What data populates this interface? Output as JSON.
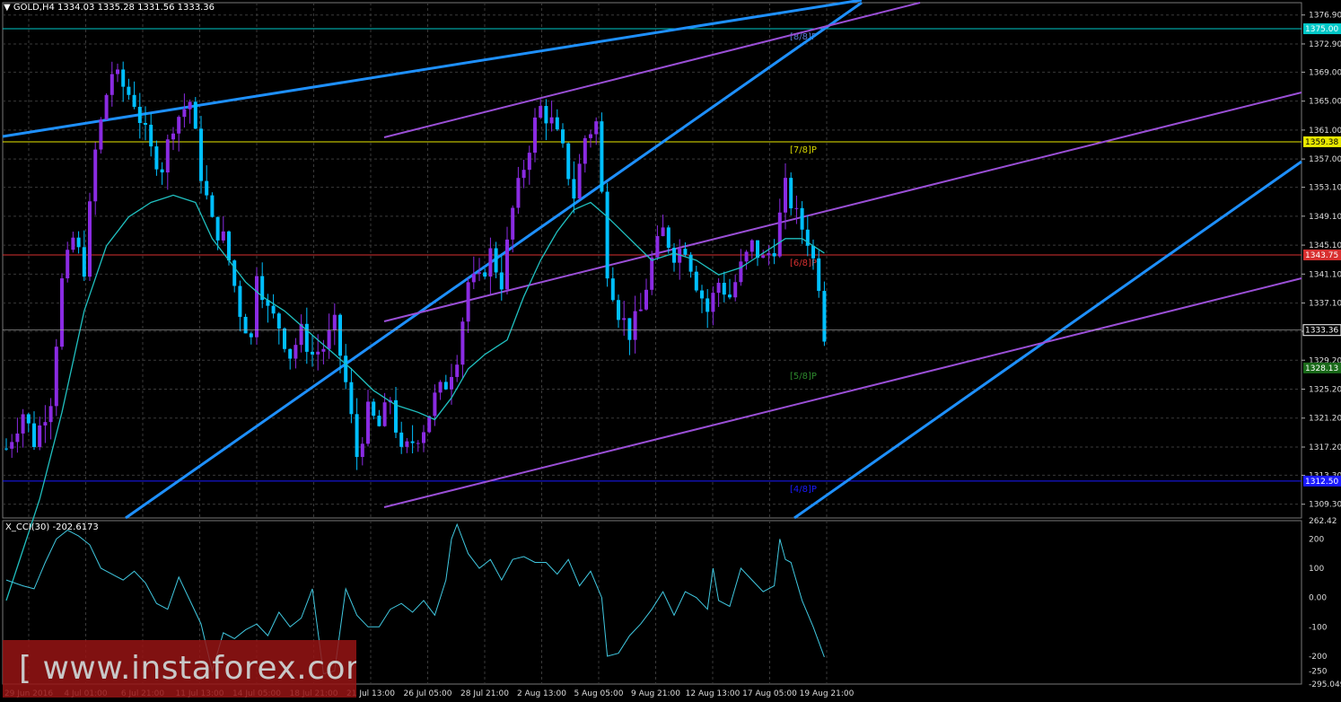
{
  "header": {
    "symbol": "GOLD,H4",
    "ohlc": "1334.03 1335.28 1331.56 1333.36"
  },
  "cci_header": "X_CCI(30) -202.6173",
  "watermark": "[ www.instaforex.com ]",
  "colors": {
    "background": "#000000",
    "grid": "#3a3a3a",
    "bull": "#8a2be2",
    "bear": "#00bfff",
    "bull_body": "#4fd44f",
    "ma": "#20c0c0",
    "channel_blue": "#1e90ff",
    "channel_purple": "#9a4fd6",
    "cci": "#40c8e0"
  },
  "chart_data": [
    {
      "type": "candlestick",
      "symbol": "GOLD",
      "timeframe": "H4",
      "ylim": [
        1307.4,
        1378.6
      ],
      "y_ticks": [
        "1376.90",
        "1372.90",
        "1369.00",
        "1365.00",
        "1361.00",
        "1357.00",
        "1353.10",
        "1349.10",
        "1345.10",
        "1341.10",
        "1337.10",
        "1333.20",
        "1329.20",
        "1325.20",
        "1321.20",
        "1317.20",
        "1313.30",
        "1309.30"
      ],
      "x_ticks": [
        "29 Jun 2016",
        "4 Jul 01:00",
        "6 Jul 21:00",
        "11 Jul 13:00",
        "14 Jul 05:00",
        "18 Jul 21:00",
        "21 Jul 13:00",
        "26 Jul 05:00",
        "28 Jul 21:00",
        "2 Aug 13:00",
        "5 Aug 05:00",
        "9 Aug 21:00",
        "12 Aug 13:00",
        "17 Aug 05:00",
        "19 Aug 21:00"
      ],
      "current_price": "1333.36",
      "close_path": [
        [
          0,
          1317
        ],
        [
          3,
          1322
        ],
        [
          5,
          1318
        ],
        [
          8,
          1324
        ],
        [
          10,
          1340
        ],
        [
          12,
          1346
        ],
        [
          14,
          1342
        ],
        [
          16,
          1358
        ],
        [
          18,
          1366
        ],
        [
          19,
          1369
        ],
        [
          21,
          1367
        ],
        [
          23,
          1365
        ],
        [
          26,
          1358
        ],
        [
          28,
          1356
        ],
        [
          30,
          1362
        ],
        [
          33,
          1365
        ],
        [
          35,
          1355
        ],
        [
          37,
          1348
        ],
        [
          39,
          1346
        ],
        [
          40,
          1343
        ],
        [
          42,
          1336
        ],
        [
          44,
          1332
        ],
        [
          45,
          1342
        ],
        [
          47,
          1336
        ],
        [
          49,
          1334
        ],
        [
          51,
          1330
        ],
        [
          53,
          1333
        ],
        [
          55,
          1330
        ],
        [
          57,
          1331
        ],
        [
          59,
          1334
        ],
        [
          61,
          1326
        ],
        [
          63,
          1316
        ],
        [
          65,
          1322
        ],
        [
          67,
          1320
        ],
        [
          69,
          1324
        ],
        [
          71,
          1316
        ],
        [
          73,
          1318
        ],
        [
          75,
          1320
        ],
        [
          77,
          1324
        ],
        [
          79,
          1326
        ],
        [
          81,
          1330
        ],
        [
          83,
          1340
        ],
        [
          85,
          1340
        ],
        [
          87,
          1344
        ],
        [
          89,
          1340
        ],
        [
          91,
          1350
        ],
        [
          93,
          1356
        ],
        [
          95,
          1362
        ],
        [
          96,
          1364
        ],
        [
          98,
          1362
        ],
        [
          100,
          1358
        ],
        [
          102,
          1352
        ],
        [
          104,
          1360
        ],
        [
          106,
          1362
        ],
        [
          108,
          1342
        ],
        [
          110,
          1336
        ],
        [
          112,
          1333
        ],
        [
          114,
          1336
        ],
        [
          116,
          1343
        ],
        [
          118,
          1347
        ],
        [
          120,
          1344
        ],
        [
          122,
          1345
        ],
        [
          124,
          1340
        ],
        [
          126,
          1336
        ],
        [
          128,
          1340
        ],
        [
          130,
          1338
        ],
        [
          132,
          1342
        ],
        [
          134,
          1345
        ],
        [
          136,
          1343
        ],
        [
          138,
          1345
        ],
        [
          140,
          1353
        ],
        [
          142,
          1349
        ],
        [
          144,
          1346
        ],
        [
          146,
          1340
        ],
        [
          147,
          1333
        ]
      ],
      "ma_path": [
        [
          0,
          1296
        ],
        [
          6,
          1310
        ],
        [
          10,
          1322
        ],
        [
          14,
          1336
        ],
        [
          18,
          1345
        ],
        [
          22,
          1349
        ],
        [
          26,
          1351
        ],
        [
          30,
          1352
        ],
        [
          34,
          1351
        ],
        [
          37,
          1346
        ],
        [
          40,
          1343
        ],
        [
          43,
          1340
        ],
        [
          46,
          1338
        ],
        [
          50,
          1336
        ],
        [
          53,
          1334
        ],
        [
          56,
          1332
        ],
        [
          59,
          1330
        ],
        [
          62,
          1328
        ],
        [
          66,
          1325
        ],
        [
          70,
          1323
        ],
        [
          74,
          1322
        ],
        [
          77,
          1321
        ],
        [
          80,
          1324
        ],
        [
          83,
          1328
        ],
        [
          86,
          1330
        ],
        [
          90,
          1332
        ],
        [
          93,
          1338
        ],
        [
          96,
          1343
        ],
        [
          99,
          1347
        ],
        [
          102,
          1350
        ],
        [
          105,
          1351
        ],
        [
          108,
          1349
        ],
        [
          112,
          1346
        ],
        [
          116,
          1343
        ],
        [
          120,
          1344
        ],
        [
          124,
          1343
        ],
        [
          128,
          1341
        ],
        [
          132,
          1342
        ],
        [
          136,
          1344
        ],
        [
          140,
          1346
        ],
        [
          143,
          1346
        ],
        [
          147,
          1344
        ]
      ],
      "horizontal_levels": [
        {
          "price": 1375.0,
          "label": "[8/8]P",
          "price_label": "1375.00",
          "color": "#00c8c8",
          "label_color": "#5a7cd8"
        },
        {
          "price": 1359.38,
          "label": "[7/8]P",
          "price_label": "1359.38",
          "color": "#e8e800",
          "label_color": "#d8d800"
        },
        {
          "price": 1343.75,
          "label": "[6/8]P",
          "price_label": "1343.75",
          "color": "#d83030",
          "label_color": "#d83030"
        },
        {
          "price": 1328.13,
          "label": "[5/8]P",
          "price_label": "1328.13",
          "color": "#000000",
          "label_color": "#2e8b2e"
        },
        {
          "price": 1312.5,
          "label": "[4/8]P",
          "price_label": "1312.50",
          "color": "#1a1aff",
          "label_color": "#1a1aff"
        }
      ]
    },
    {
      "type": "line",
      "name": "X_CCI(30)",
      "current_value": -202.6173,
      "y_ticks": [
        "262.42",
        "200",
        "100",
        "0.00",
        "-100",
        "-200",
        "-250",
        "-295.049"
      ],
      "ylim": [
        -295.049,
        262.42
      ],
      "values": [
        [
          0,
          60
        ],
        [
          3,
          40
        ],
        [
          5,
          30
        ],
        [
          7,
          120
        ],
        [
          9,
          200
        ],
        [
          11,
          230
        ],
        [
          13,
          210
        ],
        [
          15,
          180
        ],
        [
          17,
          100
        ],
        [
          19,
          80
        ],
        [
          21,
          60
        ],
        [
          23,
          90
        ],
        [
          25,
          50
        ],
        [
          27,
          -20
        ],
        [
          29,
          -40
        ],
        [
          31,
          70
        ],
        [
          33,
          -10
        ],
        [
          35,
          -90
        ],
        [
          37,
          -250
        ],
        [
          39,
          -120
        ],
        [
          41,
          -140
        ],
        [
          43,
          -110
        ],
        [
          45,
          -90
        ],
        [
          47,
          -130
        ],
        [
          49,
          -50
        ],
        [
          51,
          -100
        ],
        [
          53,
          -70
        ],
        [
          55,
          30
        ],
        [
          57,
          -260
        ],
        [
          59,
          -250
        ],
        [
          61,
          30
        ],
        [
          63,
          -60
        ],
        [
          65,
          -100
        ],
        [
          67,
          -100
        ],
        [
          69,
          -40
        ],
        [
          71,
          -20
        ],
        [
          73,
          -50
        ],
        [
          75,
          -10
        ],
        [
          77,
          -60
        ],
        [
          79,
          60
        ],
        [
          80,
          200
        ],
        [
          81,
          250
        ],
        [
          83,
          150
        ],
        [
          85,
          100
        ],
        [
          87,
          130
        ],
        [
          89,
          60
        ],
        [
          91,
          130
        ],
        [
          93,
          140
        ],
        [
          95,
          120
        ],
        [
          97,
          120
        ],
        [
          99,
          80
        ],
        [
          101,
          130
        ],
        [
          103,
          40
        ],
        [
          105,
          90
        ],
        [
          107,
          0
        ],
        [
          108,
          -200
        ],
        [
          110,
          -190
        ],
        [
          112,
          -130
        ],
        [
          114,
          -90
        ],
        [
          116,
          -40
        ],
        [
          118,
          20
        ],
        [
          120,
          -60
        ],
        [
          122,
          20
        ],
        [
          124,
          0
        ],
        [
          126,
          -40
        ],
        [
          127,
          100
        ],
        [
          128,
          -10
        ],
        [
          130,
          -30
        ],
        [
          132,
          100
        ],
        [
          134,
          60
        ],
        [
          136,
          20
        ],
        [
          138,
          40
        ],
        [
          139,
          200
        ],
        [
          140,
          130
        ],
        [
          141,
          120
        ],
        [
          143,
          -10
        ],
        [
          145,
          -100
        ],
        [
          147,
          -203
        ]
      ]
    }
  ]
}
